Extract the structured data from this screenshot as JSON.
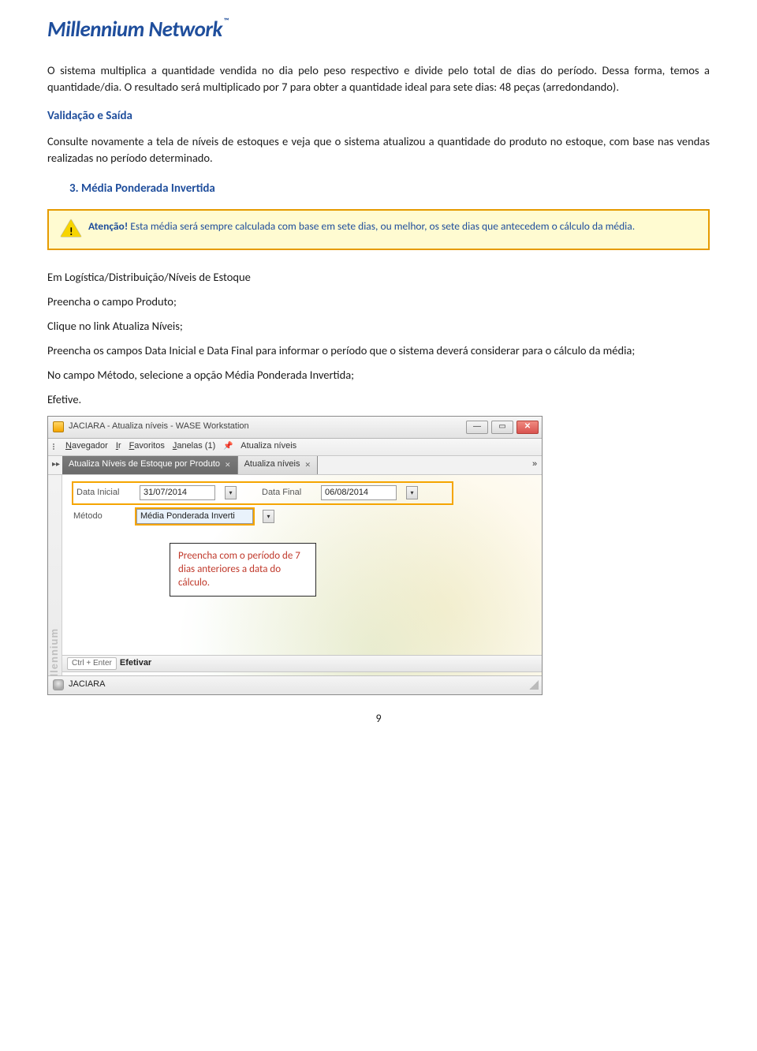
{
  "logo": {
    "text": "Millennium Network",
    "tm": "™"
  },
  "para1": "O sistema multiplica a quantidade vendida no dia pelo peso respectivo e divide pelo total de dias do período. Dessa forma, temos a quantidade/dia. O resultado será multiplicado por 7 para obter a quantidade ideal para sete dias: 48 peças (arredondando).",
  "section_validacao_title": "Validação e Saída",
  "section_validacao_body": "Consulte novamente a tela de níveis de estoques e veja que o sistema atualizou a quantidade do produto no estoque, com base nas vendas realizadas no período determinado.",
  "numbered_title": "3.   Média Ponderada Invertida",
  "warning_label": "Atenção! ",
  "warning_text": "Esta média será sempre calculada com base em sete dias, ou melhor, os sete dias que antecedem o cálculo da média.",
  "steps": {
    "s1": "Em Logística/Distribuição/Níveis de Estoque",
    "s2": "Preencha o campo Produto;",
    "s3": "Clique no link Atualiza Níveis;",
    "s4": "Preencha os campos Data Inicial e Data Final para informar o período que o sistema deverá considerar para o cálculo da média;",
    "s5": "No campo Método, selecione a opção Média Ponderada Invertida;",
    "s6": "Efetive."
  },
  "app": {
    "title": "JACIARA - Atualiza níveis - WASE Workstation",
    "menu": {
      "navegador": "Navegador",
      "ir": "Ir",
      "favoritos": "Favoritos",
      "janelas": "Janelas (1)",
      "crumb": "Atualiza níveis"
    },
    "tabs": {
      "t1": "Atualiza Níveis de Estoque por Produto",
      "t2": "Atualiza níveis"
    },
    "form": {
      "data_inicial_label": "Data Inicial",
      "data_inicial_value": "31/07/2014",
      "data_final_label": "Data Final",
      "data_final_value": "06/08/2014",
      "metodo_label": "Método",
      "metodo_value": "Média Ponderada Inverti"
    },
    "callout": "Preencha com o período de 7 dias anteriores a data do cálculo.",
    "efetivar_key": "Ctrl + Enter",
    "efetivar_label": "Efetivar",
    "status_user": "JACIARA",
    "leftrail": "Millennium"
  },
  "page_number": "9"
}
